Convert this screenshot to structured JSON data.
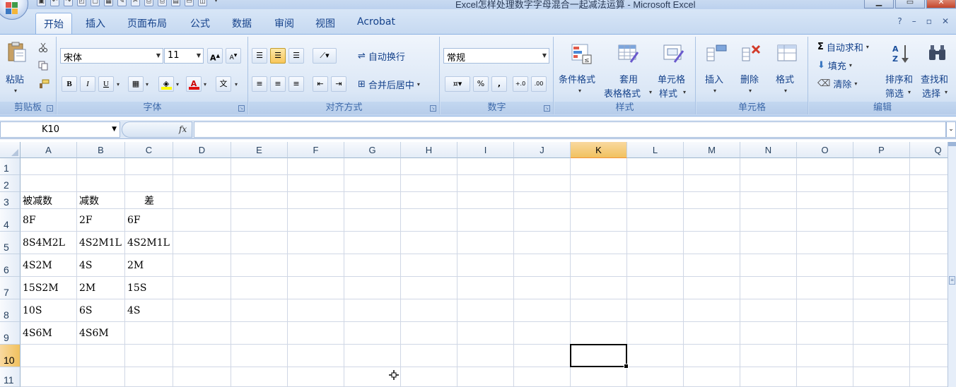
{
  "window": {
    "title": "Excel怎样处理数字字母混合一起减法运算 - Microsoft Excel"
  },
  "tabs": [
    {
      "label": "开始",
      "active": true
    },
    {
      "label": "插入"
    },
    {
      "label": "页面布局"
    },
    {
      "label": "公式"
    },
    {
      "label": "数据"
    },
    {
      "label": "审阅"
    },
    {
      "label": "视图"
    },
    {
      "label": "Acrobat"
    }
  ],
  "ribbon": {
    "clipboard": {
      "paste": "粘贴",
      "label": "剪贴板"
    },
    "font": {
      "name": "宋体",
      "size": "11",
      "label": "字体",
      "bold": "B",
      "italic": "I",
      "underline": "U",
      "grow": "A",
      "shrink": "A",
      "font_color_glyph": "A",
      "phonetic_glyph": "文"
    },
    "alignment": {
      "wrap": "自动换行",
      "merge": "合并后居中",
      "label": "对齐方式"
    },
    "number": {
      "format": "常规",
      "percent": "%",
      "comma": ",",
      "label": "数字"
    },
    "styles": {
      "conditional": "条件格式",
      "table_line1": "套用",
      "table_line2": "表格格式",
      "cell_line1": "单元格",
      "cell_line2": "样式",
      "label": "样式"
    },
    "cells": {
      "insert": "插入",
      "delete": "删除",
      "format": "格式",
      "label": "单元格"
    },
    "editing": {
      "sum_glyph": "Σ",
      "autosum": "自动求和",
      "fill": "填充",
      "clear": "清除",
      "sort_line1": "排序和",
      "sort_line2": "筛选",
      "find_line1": "查找和",
      "find_line2": "选择",
      "label": "编辑"
    }
  },
  "formula_bar": {
    "name_box": "K10",
    "fx": "fx",
    "formula": ""
  },
  "columns": [
    "A",
    "B",
    "C",
    "D",
    "E",
    "F",
    "G",
    "H",
    "I",
    "J",
    "K",
    "L",
    "M",
    "N",
    "O",
    "P",
    "Q"
  ],
  "rows": [
    "1",
    "2",
    "3",
    "4",
    "5",
    "6",
    "7",
    "8",
    "9",
    "10",
    "11"
  ],
  "selected": {
    "column": "K",
    "row": "10"
  },
  "cells": [
    {
      "col": 0,
      "row": 2,
      "value": "被减数"
    },
    {
      "col": 1,
      "row": 2,
      "value": "减数"
    },
    {
      "col": 2,
      "row": 2,
      "value": "差",
      "center": true
    },
    {
      "col": 0,
      "row": 3,
      "value": "8F"
    },
    {
      "col": 1,
      "row": 3,
      "value": "2F"
    },
    {
      "col": 2,
      "row": 3,
      "value": "6F"
    },
    {
      "col": 0,
      "row": 4,
      "value": "8S4M2L"
    },
    {
      "col": 1,
      "row": 4,
      "value": "4S2M1L"
    },
    {
      "col": 2,
      "row": 4,
      "value": "4S2M1L"
    },
    {
      "col": 0,
      "row": 5,
      "value": "4S2M"
    },
    {
      "col": 1,
      "row": 5,
      "value": "4S"
    },
    {
      "col": 2,
      "row": 5,
      "value": "2M"
    },
    {
      "col": 0,
      "row": 6,
      "value": "15S2M"
    },
    {
      "col": 1,
      "row": 6,
      "value": "2M"
    },
    {
      "col": 2,
      "row": 6,
      "value": "15S"
    },
    {
      "col": 0,
      "row": 7,
      "value": "10S"
    },
    {
      "col": 1,
      "row": 7,
      "value": "6S"
    },
    {
      "col": 2,
      "row": 7,
      "value": "4S"
    },
    {
      "col": 0,
      "row": 8,
      "value": "4S6M"
    },
    {
      "col": 1,
      "row": 8,
      "value": "4S6M"
    }
  ],
  "colors": {
    "ribbon_text": "#15428b",
    "selection_header": "#f1c15f",
    "grid_line": "#d0d7e5"
  }
}
